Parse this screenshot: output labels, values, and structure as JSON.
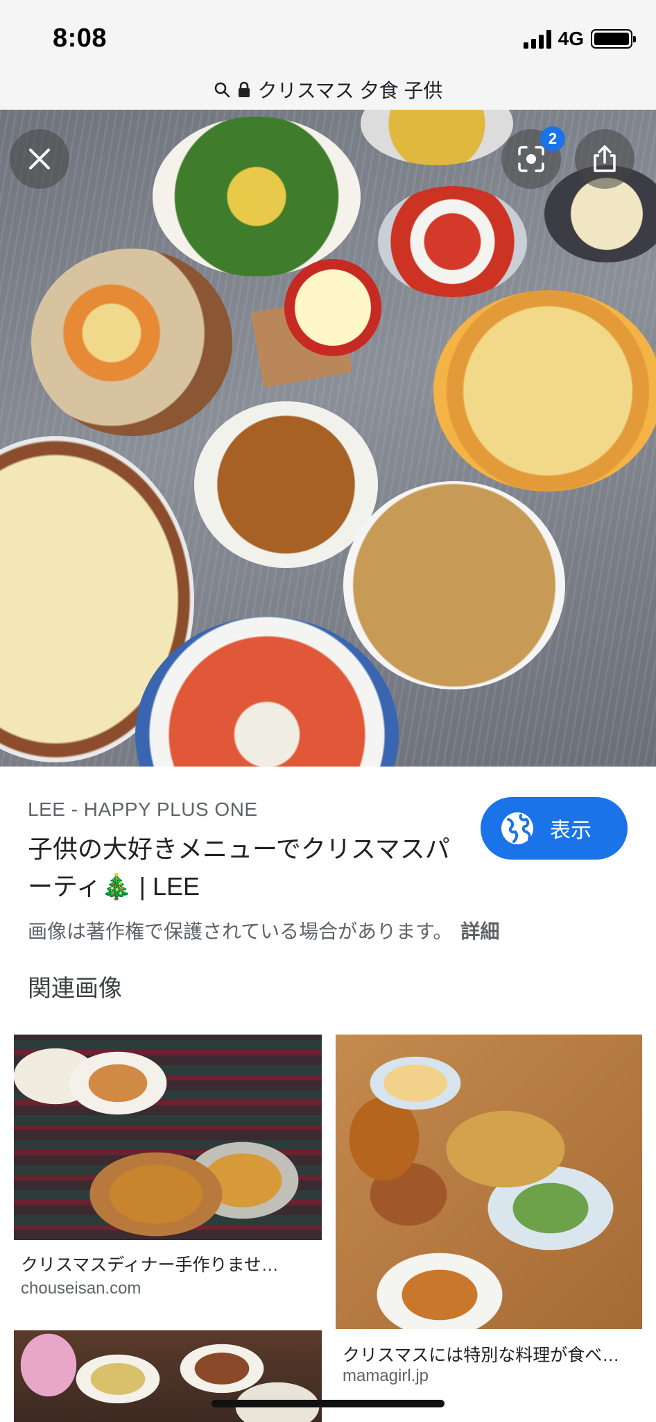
{
  "status_bar": {
    "time": "8:08",
    "network": "4G"
  },
  "url_bar": {
    "query": "クリスマス 夕食 子供"
  },
  "viewer": {
    "lens_badge_count": "2"
  },
  "result": {
    "source": "LEE - HAPPY PLUS ONE",
    "title_line1": "子供の大好きメニューでクリスマスパ",
    "title_line2": "ーティ🎄 | LEE",
    "visit_button": "表示",
    "copyright_notice": "画像は著作権で保護されている場合があります。",
    "details_link": "詳細"
  },
  "related": {
    "heading": "関連画像",
    "items": [
      {
        "title": "クリスマスディナー手作りませ…",
        "source": "chouseisan.com"
      },
      {
        "title": "クリスマスには特別な料理が食べ…",
        "source": "mamagirl.jp"
      },
      {
        "title": "",
        "source": ""
      }
    ]
  },
  "colors": {
    "accent": "#1a73e8",
    "status_bg": "#f5f5f5"
  },
  "icons": [
    "search-icon",
    "lock-icon",
    "close-icon",
    "lens-icon",
    "share-icon",
    "globe-icon"
  ]
}
